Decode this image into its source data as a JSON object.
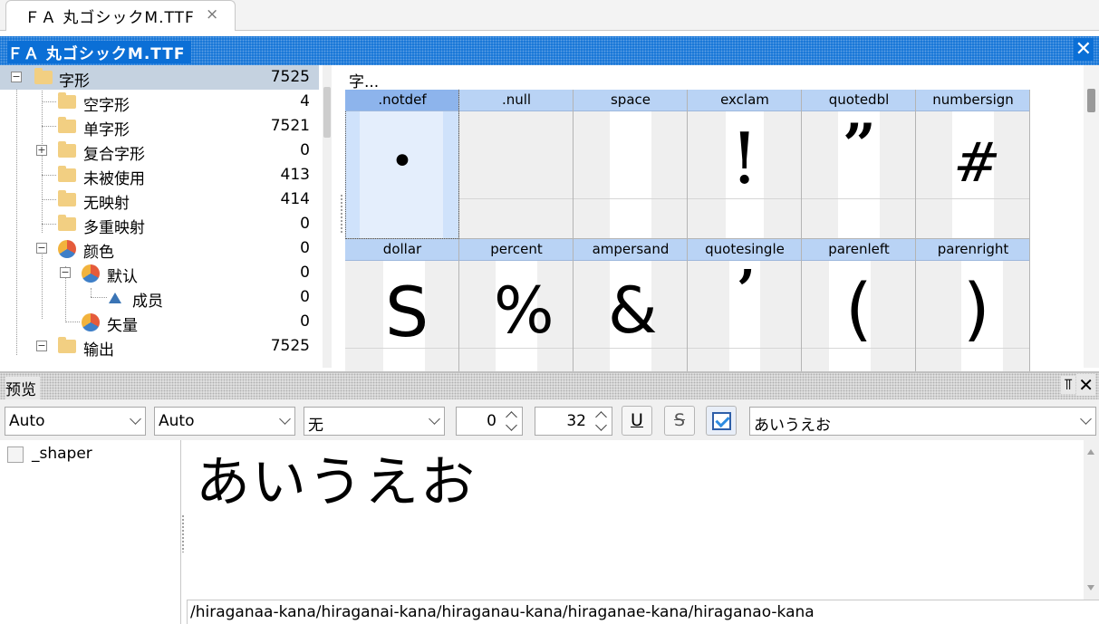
{
  "tab": {
    "title": "ＦＡ 丸ゴシックM.TTF",
    "close": "×"
  },
  "document": {
    "title": "ＦＡ 丸ゴシックM.TTF",
    "close": "✕"
  },
  "tree": {
    "items": [
      {
        "label": "字形",
        "count": "7525",
        "expander": "−",
        "icon": "folder-icon"
      },
      {
        "label": "空字形",
        "count": "4",
        "icon": "folder-icon"
      },
      {
        "label": "单字形",
        "count": "7521",
        "icon": "folder-icon"
      },
      {
        "label": "复合字形",
        "count": "0",
        "expander": "+",
        "icon": "folder-icon"
      },
      {
        "label": "未被使用",
        "count": "413",
        "icon": "folder-icon"
      },
      {
        "label": "无映射",
        "count": "414",
        "icon": "folder-icon"
      },
      {
        "label": "多重映射",
        "count": "0",
        "icon": "folder-icon"
      },
      {
        "label": "颜色",
        "count": "0",
        "expander": "−",
        "icon": "palette-icon"
      },
      {
        "label": "默认",
        "count": "0",
        "expander": "−",
        "icon": "palette-icon"
      },
      {
        "label": "成员",
        "count": "0",
        "icon": "triangle-icon"
      },
      {
        "label": "矢量",
        "count": "0",
        "icon": "palette-icon"
      },
      {
        "label": "输出",
        "count": "7525",
        "expander": "−",
        "icon": "folder-icon"
      }
    ]
  },
  "glyph_grid": {
    "header": "字...",
    "cells": [
      {
        "name": ".notdef",
        "glyph": "•"
      },
      {
        "name": ".null",
        "glyph": ""
      },
      {
        "name": "space",
        "glyph": ""
      },
      {
        "name": "exclam",
        "glyph": "!"
      },
      {
        "name": "quotedbl",
        "glyph": "”"
      },
      {
        "name": "numbersign",
        "glyph": "#"
      },
      {
        "name": "dollar",
        "glyph": "S"
      },
      {
        "name": "percent",
        "glyph": "%"
      },
      {
        "name": "ampersand",
        "glyph": "&"
      },
      {
        "name": "quotesingle",
        "glyph": "’"
      },
      {
        "name": "parenleft",
        "glyph": "("
      },
      {
        "name": "parenright",
        "glyph": ")"
      }
    ]
  },
  "preview": {
    "title": "预览",
    "pin": "📌",
    "close": "✕",
    "script_select": "Auto",
    "language_select": "Auto",
    "direction_select": "无",
    "spacing_value": "0",
    "size_value": "32",
    "underline_label": "U",
    "strike_label": "S",
    "text_select": "あいうえお",
    "features": [
      {
        "label": "_shaper"
      }
    ],
    "render_text": "あいうえお",
    "glyph_names": "/hiraganaa-kana/hiraganai-kana/hiraganau-kana/hiraganae-kana/hiraganao-kana"
  }
}
